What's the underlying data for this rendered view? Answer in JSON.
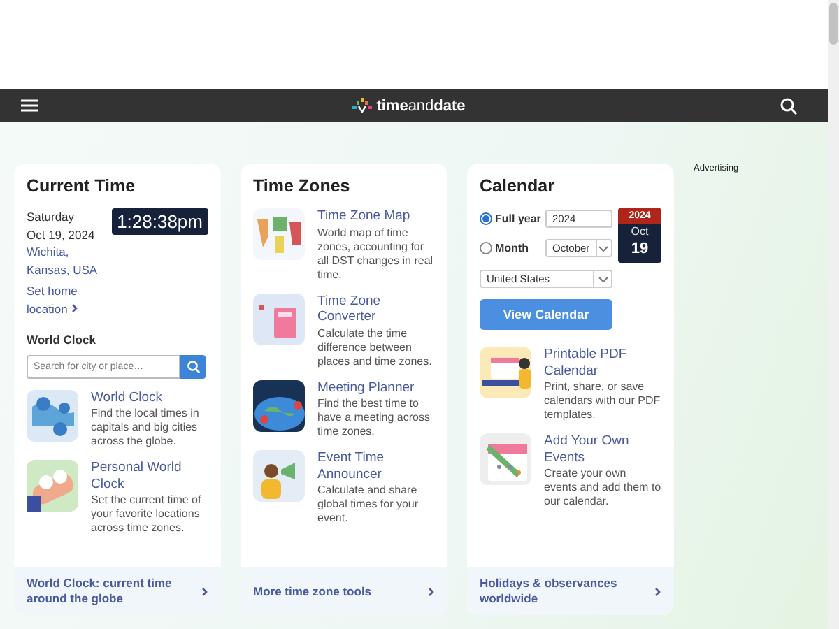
{
  "header": {
    "logo": "**time**and**date**"
  },
  "advertising": "Advertising",
  "current_time": {
    "title": "Current Time",
    "day": "Saturday",
    "date": "Oct 19, 2024",
    "location": "Wichita, Kansas, USA",
    "clock": "1:28:38pm",
    "home_link": "Set home location",
    "section": "World Clock",
    "search": {
      "placeholder": "Search for city or place…"
    },
    "items": [
      {
        "kind": "world_clock",
        "title": "World Clock",
        "text": "Find the local times in capitals and big cities across the globe."
      },
      {
        "kind": "personal_clock",
        "title": "Personal World Clock",
        "text": "Set the current time of your favorite locations across time zones."
      }
    ],
    "footer": "World Clock: current time around the globe"
  },
  "time_zones": {
    "title": "Time Zones",
    "items": [
      {
        "kind": "tz_map",
        "title": "Time Zone Map",
        "text": "World map of time zones, accounting for all DST changes in real time."
      },
      {
        "kind": "converter",
        "title": "Time Zone Converter",
        "text": "Calculate the time difference between places and time zones."
      },
      {
        "kind": "meeting",
        "title": "Meeting Planner",
        "text": "Find the best time to have a meeting across time zones."
      },
      {
        "kind": "announcer",
        "title": "Event Time Announcer",
        "text": "Calculate and share global times for your event."
      }
    ],
    "footer": "More time zone tools"
  },
  "calendar": {
    "title": "Calendar",
    "modes": [
      {
        "label": "Full year",
        "selected": true
      },
      {
        "label": "Month",
        "selected": false
      }
    ],
    "year": "2024",
    "month": "October",
    "country": "United States",
    "button": "View Calendar",
    "badge": {
      "year": "2024",
      "month": "Oct",
      "day": "19"
    },
    "items": [
      {
        "kind": "pdf",
        "title": "Printable PDF Calendar",
        "text": "Print, share, or save calendars with our PDF templates."
      },
      {
        "kind": "events",
        "title": "Add Your Own Events",
        "text": "Create your own events and add them to our calendar."
      }
    ],
    "footer": "Holidays & observances worldwide"
  }
}
